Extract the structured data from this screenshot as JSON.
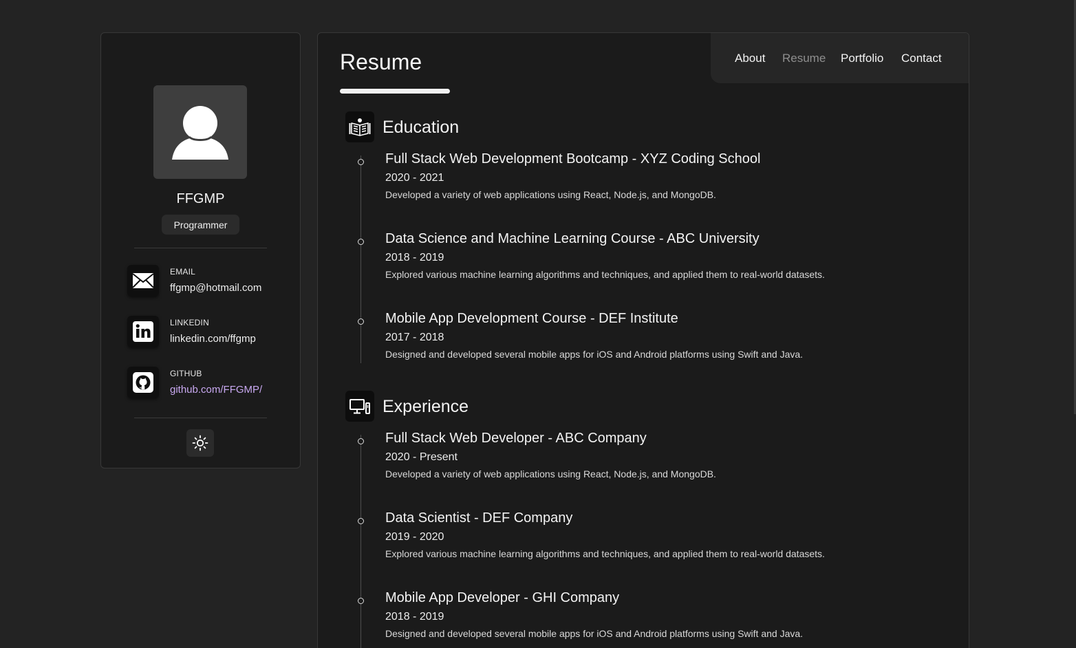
{
  "profile": {
    "name": "FFGMP",
    "role": "Programmer"
  },
  "contacts": [
    {
      "label": "EMAIL",
      "value": "ffgmp@hotmail.com",
      "icon": "mail-icon"
    },
    {
      "label": "LINKEDIN",
      "value": "linkedin.com/ffgmp",
      "icon": "linkedin-icon"
    },
    {
      "label": "GITHUB",
      "value": "github.com/FFGMP/",
      "icon": "github-icon"
    }
  ],
  "theme_toggle": {
    "icon": "sun-icon"
  },
  "nav": {
    "items": [
      "About",
      "Resume",
      "Portfolio",
      "Contact"
    ],
    "active": "Resume"
  },
  "page": {
    "title": "Resume"
  },
  "education": {
    "title": "Education",
    "icon": "book-reader-icon",
    "items": [
      {
        "title": "Full Stack Web Development Bootcamp - XYZ Coding School",
        "date": "2020 - 2021",
        "desc": "Developed a variety of web applications using React, Node.js, and MongoDB."
      },
      {
        "title": "Data Science and Machine Learning Course - ABC University",
        "date": "2018 - 2019",
        "desc": "Explored various machine learning algorithms and techniques, and applied them to real-world datasets."
      },
      {
        "title": "Mobile App Development Course - DEF Institute",
        "date": "2017 - 2018",
        "desc": "Designed and developed several mobile apps for iOS and Android platforms using Swift and Java."
      }
    ]
  },
  "experience": {
    "title": "Experience",
    "icon": "devices-icon",
    "items": [
      {
        "title": "Full Stack Web Developer - ABC Company",
        "date": "2020 - Present",
        "desc": "Developed a variety of web applications using React, Node.js, and MongoDB."
      },
      {
        "title": "Data Scientist - DEF Company",
        "date": "2019 - 2020",
        "desc": "Explored various machine learning algorithms and techniques, and applied them to real-world datasets."
      },
      {
        "title": "Mobile App Developer - GHI Company",
        "date": "2018 - 2019",
        "desc": "Designed and developed several mobile apps for iOS and Android platforms using Swift and Java."
      }
    ]
  },
  "colors": {
    "background": "#232323",
    "panel": "#1b1b1b",
    "link_accent": "#c8a8f0"
  }
}
